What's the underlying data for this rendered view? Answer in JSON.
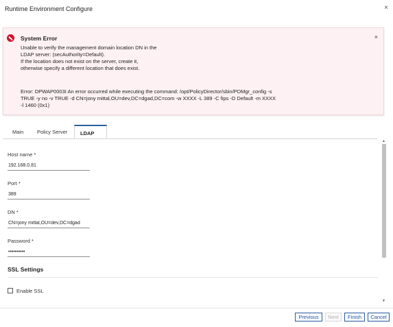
{
  "window": {
    "title": "Runtime Environment Configure",
    "close_glyph": "×"
  },
  "error": {
    "title": "System Error",
    "close_glyph": "×",
    "message_lines": [
      "Unable to verify the management domain location DN in the",
      "LDAP server: (secAuthority=Default).",
      "If the location does not exist on the server, create it,",
      "otherwise specify a different location that does exist."
    ],
    "detail_lines": [
      "Error: DPWAP0003I An error occurred while executing the command: /opt/PolicyDirector/sbin/PDMgr_config -s",
      "TRUE -y no -v TRUE -d CN=jony mittal,OU=dev,DC=dgad,DC=com -w XXXX -L 389 -C fips -D Default -m XXXX",
      "-l 1460 (0x1)"
    ],
    "accent_color": "#d3132c"
  },
  "tabs": [
    {
      "label": "Main",
      "active": false
    },
    {
      "label": "Policy Server",
      "active": false
    },
    {
      "label": "LDAP",
      "active": true
    }
  ],
  "form": {
    "host_name": {
      "label": "Host name *",
      "value": "192.168.0.81"
    },
    "port": {
      "label": "Port *",
      "value": "389"
    },
    "dn": {
      "label": "DN *",
      "value": "CN=jony mittal,OU=dev,DC=dgad"
    },
    "password": {
      "label": "Password *",
      "value": "••••••••••"
    },
    "ssl_section": "SSL Settings",
    "enable_ssl": {
      "label": "Enable SSL",
      "checked": false
    }
  },
  "footer": {
    "previous": "Previous",
    "next": "Next",
    "finish": "Finish",
    "cancel": "Cancel",
    "accent_color": "#2a5d9f"
  }
}
